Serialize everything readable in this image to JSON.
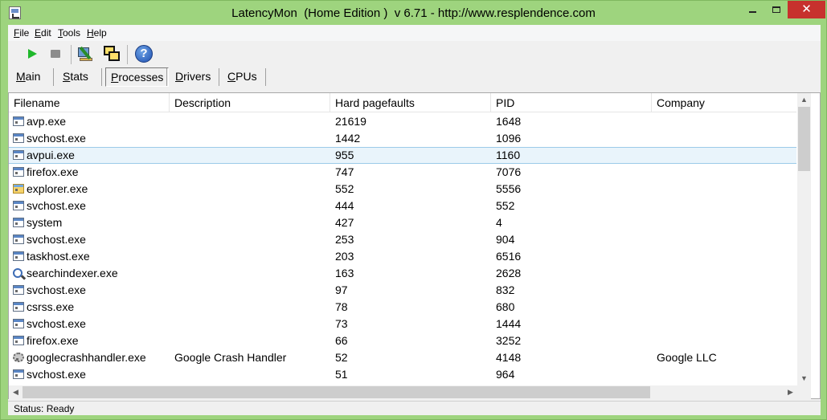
{
  "window": {
    "title": "LatencyMon  (Home Edition )  v 6.71 - http://www.resplendence.com",
    "close_glyph": "✕"
  },
  "menu": [
    {
      "label": "File",
      "mnemonic": "F",
      "rest": "ile"
    },
    {
      "label": "Edit",
      "mnemonic": "E",
      "rest": "dit"
    },
    {
      "label": "Tools",
      "mnemonic": "T",
      "rest": "ools"
    },
    {
      "label": "Help",
      "mnemonic": "H",
      "rest": "elp"
    }
  ],
  "toolbar": {
    "icons": [
      "play-icon",
      "stop-icon",
      "monitor-icon",
      "windows-icon",
      "help-icon"
    ],
    "help_glyph": "?"
  },
  "tabs": [
    {
      "label": "Main",
      "mnemonic": "M",
      "rest": "ain"
    },
    {
      "label": "Stats",
      "mnemonic": "S",
      "rest": "tats"
    },
    {
      "label": "Processes",
      "mnemonic": "P",
      "rest": "rocesses",
      "active": true
    },
    {
      "label": "Drivers",
      "mnemonic": "D",
      "rest": "rivers"
    },
    {
      "label": "CPUs",
      "mnemonic": "C",
      "rest": "PUs"
    }
  ],
  "table": {
    "columns": [
      "Filename",
      "Description",
      "Hard pagefaults",
      "PID",
      "Company"
    ],
    "rows": [
      {
        "icon": "process-icon",
        "filename": "avp.exe",
        "description": "",
        "faults": "21619",
        "pid": "1648",
        "company": ""
      },
      {
        "icon": "process-icon",
        "filename": "svchost.exe",
        "description": "",
        "faults": "1442",
        "pid": "1096",
        "company": ""
      },
      {
        "icon": "process-icon",
        "filename": "avpui.exe",
        "description": "",
        "faults": "955",
        "pid": "1160",
        "company": "",
        "selected": true
      },
      {
        "icon": "process-icon",
        "filename": "firefox.exe",
        "description": "",
        "faults": "747",
        "pid": "7076",
        "company": ""
      },
      {
        "icon": "folder-icon",
        "filename": "explorer.exe",
        "description": "",
        "faults": "552",
        "pid": "5556",
        "company": ""
      },
      {
        "icon": "process-icon",
        "filename": "svchost.exe",
        "description": "",
        "faults": "444",
        "pid": "552",
        "company": ""
      },
      {
        "icon": "process-icon",
        "filename": "system",
        "description": "",
        "faults": "427",
        "pid": "4",
        "company": ""
      },
      {
        "icon": "process-icon",
        "filename": "svchost.exe",
        "description": "",
        "faults": "253",
        "pid": "904",
        "company": ""
      },
      {
        "icon": "process-icon",
        "filename": "taskhost.exe",
        "description": "",
        "faults": "203",
        "pid": "6516",
        "company": ""
      },
      {
        "icon": "search-icon",
        "filename": "searchindexer.exe",
        "description": "",
        "faults": "163",
        "pid": "2628",
        "company": ""
      },
      {
        "icon": "process-icon",
        "filename": "svchost.exe",
        "description": "",
        "faults": "97",
        "pid": "832",
        "company": ""
      },
      {
        "icon": "process-icon",
        "filename": "csrss.exe",
        "description": "",
        "faults": "78",
        "pid": "680",
        "company": ""
      },
      {
        "icon": "process-icon",
        "filename": "svchost.exe",
        "description": "",
        "faults": "73",
        "pid": "1444",
        "company": ""
      },
      {
        "icon": "process-icon",
        "filename": "firefox.exe",
        "description": "",
        "faults": "66",
        "pid": "3252",
        "company": ""
      },
      {
        "icon": "gear-icon",
        "filename": "googlecrashhandler.exe",
        "description": "Google Crash Handler",
        "faults": "52",
        "pid": "4148",
        "company": "Google LLC"
      },
      {
        "icon": "process-icon",
        "filename": "svchost.exe",
        "description": "",
        "faults": "51",
        "pid": "964",
        "company": ""
      }
    ]
  },
  "scroll": {
    "up": "▲",
    "down": "▼",
    "left": "◀",
    "right": "▶"
  },
  "status": {
    "text": "Status: Ready"
  },
  "colors": {
    "window_frame": "#9ed47e",
    "close_button": "#c7312d",
    "selection": "#e9f4fb"
  }
}
